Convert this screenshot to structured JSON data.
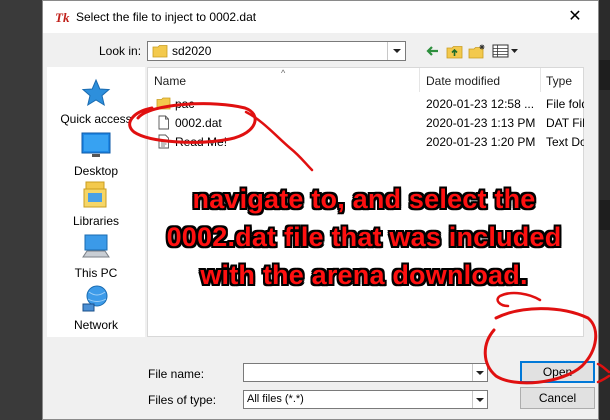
{
  "dialog": {
    "title": "Select the file to inject to 0002.dat",
    "close_glyph": "✕"
  },
  "lookin": {
    "label": "Look in:",
    "value": "sd2020"
  },
  "places": [
    {
      "label": "Quick access",
      "icon": "quick-access-icon"
    },
    {
      "label": "Desktop",
      "icon": "desktop-icon"
    },
    {
      "label": "Libraries",
      "icon": "libraries-icon"
    },
    {
      "label": "This PC",
      "icon": "this-pc-icon"
    },
    {
      "label": "Network",
      "icon": "network-icon"
    }
  ],
  "columns": {
    "name": "Name",
    "date": "Date modified",
    "type": "Type"
  },
  "files": [
    {
      "name": "pac",
      "date": "2020-01-23 12:58 ...",
      "type": "File folder",
      "icon": "folder-icon"
    },
    {
      "name": "0002.dat",
      "date": "2020-01-23 1:13 PM",
      "type": "DAT File",
      "icon": "file-icon"
    },
    {
      "name": "Read Me!",
      "date": "2020-01-23 1:20 PM",
      "type": "Text Docu",
      "icon": "text-file-icon"
    }
  ],
  "filename": {
    "label": "File name:",
    "value": ""
  },
  "filetype": {
    "label": "Files of type:",
    "value": "All files (*.*)"
  },
  "buttons": {
    "open": "Open",
    "cancel": "Cancel"
  },
  "annotation": {
    "line1": "navigate to, and select the",
    "line2": "0002.dat file that was included",
    "line3": "with the arena download.",
    "color": "#ff1010"
  }
}
